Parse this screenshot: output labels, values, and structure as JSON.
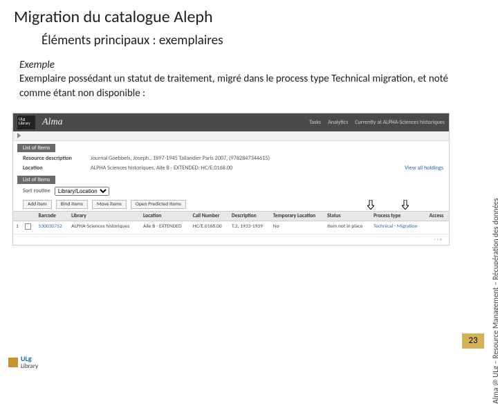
{
  "title": "Migration du catalogue Aleph",
  "subtitle": "Éléments principaux : exemplaires",
  "exemple_label": "Exemple",
  "body_text": "Exemplaire possédant un statut de traitement, migré dans le process type Technical migration, et noté comme étant non disponible :",
  "sidebar_text": "Alma @ ULg – Resource Management – Récupération des données",
  "page_number": "23",
  "logo": {
    "ulg": "ULg",
    "lib": "Library"
  },
  "alma": {
    "brand": "Alma",
    "top_links": {
      "tasks": "Tasks",
      "analytics": "Analytics",
      "currently": "Currently at",
      "unit": "ALPHA-Sciences historiques"
    },
    "ulg_badge": {
      "l1": "ULg",
      "l2": "Library"
    },
    "list_label": "List of Items",
    "resource_desc_label": "Resource description",
    "resource_desc_value": "Journal  Goebbels, Joseph., 1897-1945 Tallandier Paris  2007, (9782847344615)",
    "location_label": "Location",
    "location_value": "ALPHA Sciences historiques, Aile B - EXTENDED: HC/E.0168.00",
    "view_all": "View all holdings",
    "list_items_label": "List of Items",
    "sort_label": "Sort routine",
    "sort_value": "Library/Location",
    "buttons": {
      "add": "Add item",
      "bind": "Bind items",
      "move": "Move items",
      "open": "Open Predicted Items"
    },
    "columns": {
      "barcode": "Barcode",
      "library": "Library",
      "location": "Location",
      "call": "Call Number",
      "desc": "Description",
      "temp": "Temporary Location",
      "status": "Status",
      "ptype": "Process type",
      "access": "Access"
    },
    "row": {
      "num": "1",
      "barcode": "530030752",
      "library": "ALPHA-Sciences historiques",
      "location": "Aile B - EXTENDED",
      "call": "HC/E.0168.00",
      "desc": "T.2, 1933-1939",
      "temp": "No",
      "status": "Item not in place",
      "ptype": "Technical - Migration",
      "access": ""
    }
  }
}
